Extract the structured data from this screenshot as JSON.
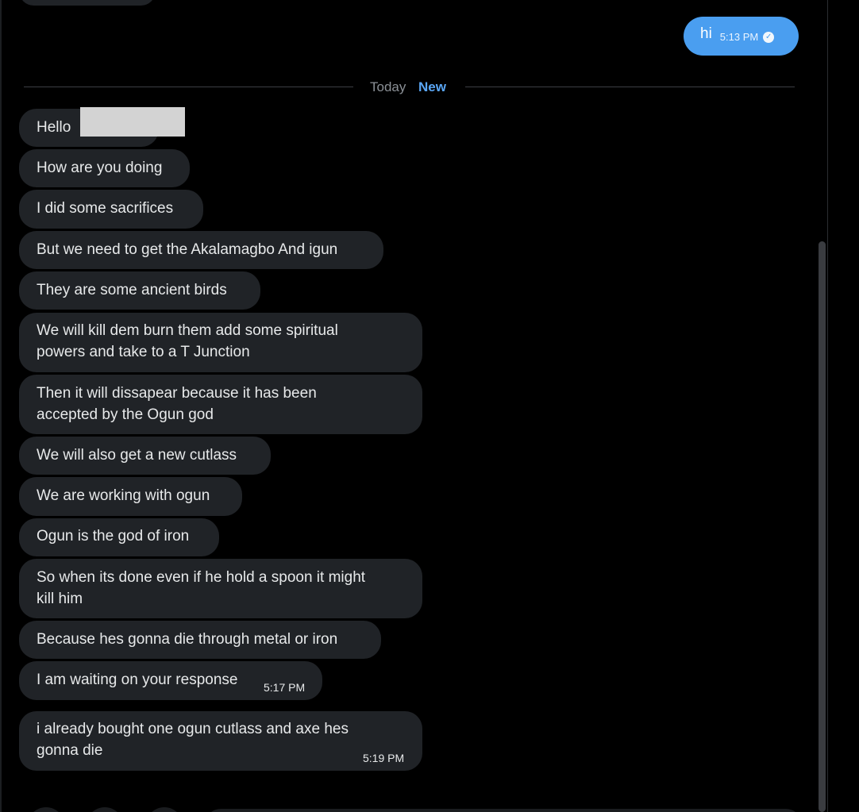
{
  "outgoing": {
    "text": "hi",
    "time": "5:13 PM"
  },
  "separator": {
    "today": "Today",
    "new": "New"
  },
  "messages": [
    {
      "text": "Hello "
    },
    {
      "text": "How are you doing"
    },
    {
      "text": "I did some sacrifices"
    },
    {
      "text": "But we need to get the Akalamagbo And igun"
    },
    {
      "text": "They are some ancient birds"
    },
    {
      "text": "We will kill dem burn them add some spiritual\npowers and take to a T Junction"
    },
    {
      "text": "Then it will dissapear because it has been\naccepted by the Ogun god"
    },
    {
      "text": "We will also get a new cutlass"
    },
    {
      "text": "We are working with ogun"
    },
    {
      "text": "Ogun is the god of iron"
    },
    {
      "text": "So when its done even if he hold a spoon it might\nkill him"
    },
    {
      "text": "Because hes gonna die through metal or iron"
    },
    {
      "text": "I am waiting on your response",
      "time": "5:17 PM"
    },
    {
      "text": "i already bought one ogun cutlass and axe hes\ngonna die",
      "time": "5:19 PM"
    }
  ],
  "icons": {
    "read_receipt": "check-circle-icon",
    "toolbar": [
      "media-icon",
      "gif-icon",
      "emoji-icon"
    ]
  },
  "colors": {
    "background": "#000000",
    "incoming_bubble": "#202327",
    "outgoing_bubble": "#4a9ef0",
    "new_label": "#5aa6f5",
    "text": "#e7e9ea"
  }
}
